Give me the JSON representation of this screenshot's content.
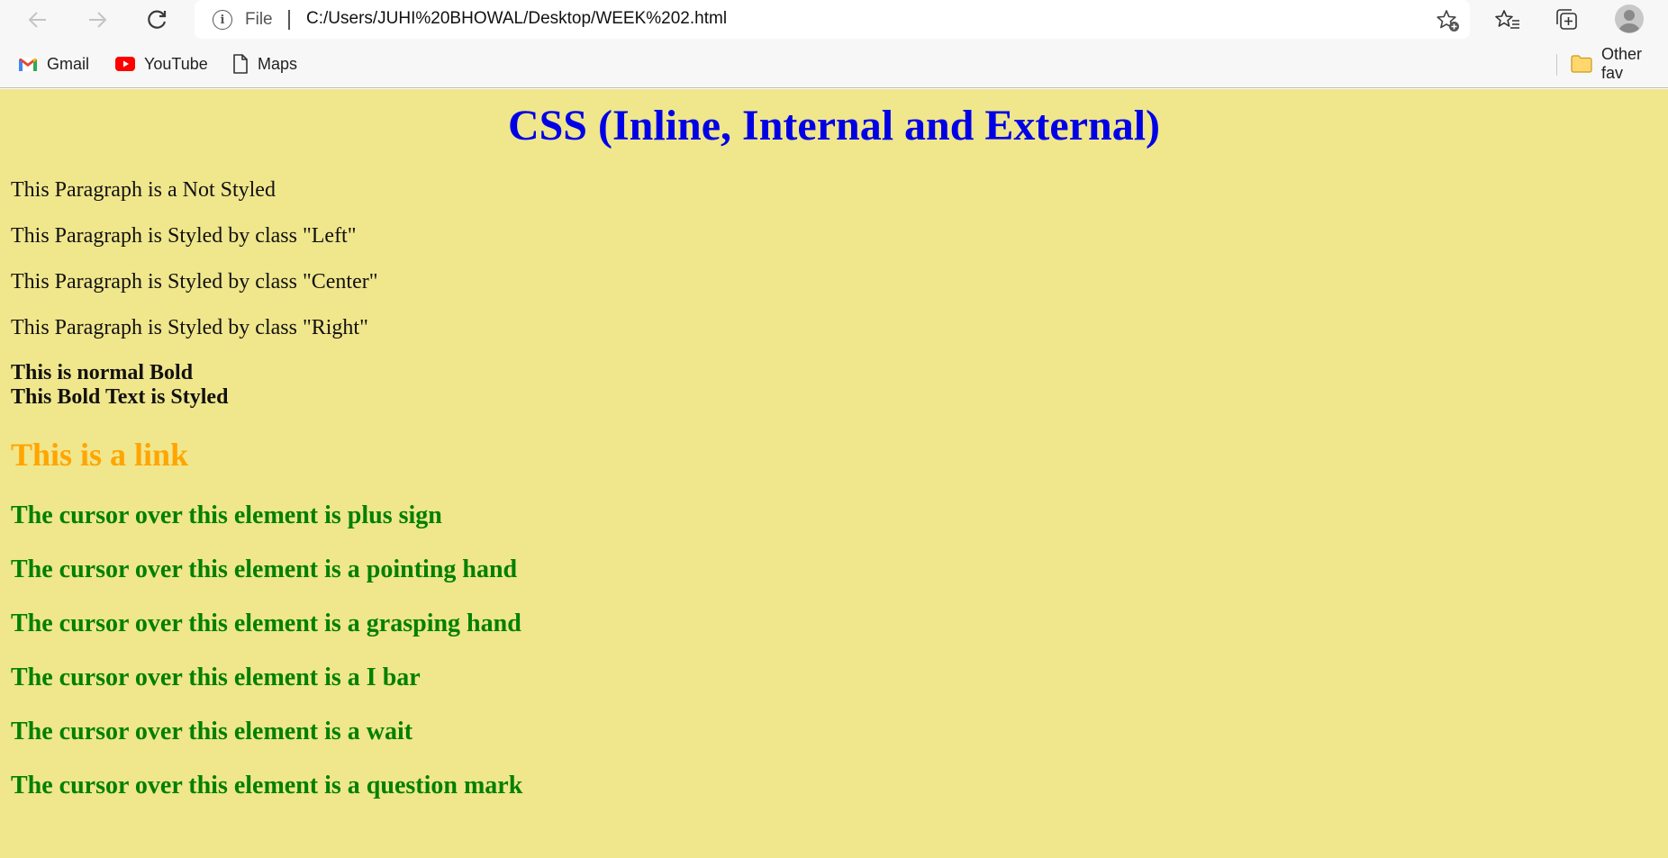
{
  "browser": {
    "address_bar": {
      "file_label": "File",
      "url": "C:/Users/JUHI%20BHOWAL/Desktop/WEEK%202.html"
    },
    "nav": {
      "back_icon": "arrow-left-icon",
      "forward_icon": "arrow-right-icon",
      "reload_icon": "reload-icon"
    },
    "bookmarks": [
      {
        "label": "Gmail",
        "icon": "gmail-icon"
      },
      {
        "label": "YouTube",
        "icon": "youtube-icon"
      },
      {
        "label": "Maps",
        "icon": "document-icon"
      }
    ],
    "other_favorites_label": "Other fav"
  },
  "page": {
    "background_color": "#f0e68c",
    "title": "CSS (Inline, Internal and External)",
    "title_color": "#0000e6",
    "paragraphs": [
      "This Paragraph is a Not Styled",
      "This Paragraph is Styled by class \"Left\"",
      "This Paragraph is Styled by class \"Center\"",
      "This Paragraph is Styled by class \"Right\""
    ],
    "bold_normal": "This is normal Bold",
    "bold_styled": "This Bold Text is Styled",
    "link_text": "This is a link",
    "link_color": "#ffa500",
    "cursor_color": "#008000",
    "cursor_lines": [
      "The cursor over this element is plus sign",
      "The cursor over this element is a pointing hand",
      "The cursor over this element is a grasping hand",
      "The cursor over this element is a I bar",
      "The cursor over this element is a wait",
      "The cursor over this element is a question mark"
    ]
  }
}
